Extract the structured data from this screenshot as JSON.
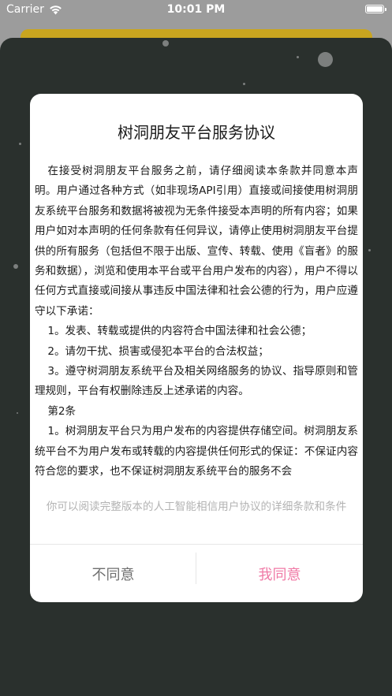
{
  "status_bar": {
    "carrier": "Carrier",
    "time": "10:01 PM"
  },
  "dialog": {
    "title": "树洞朋友平台服务协议",
    "paragraphs": [
      "在接受树洞朋友平台服务之前，请仔细阅读本条款并同意本声明。用户通过各种方式（如非现场API引用）直接或间接使用树洞朋友系统平台服务和数据将被视为无条件接受本声明的所有内容；如果用户如对本声明的任何条款有任何异议，请停止使用树洞朋友平台提供的所有服务（包括但不限于出版、宣传、转载、使用《盲者》的服务和数据），浏览和使用本平台或平台用户发布的内容），用户不得以任何方式直接或间接从事违反中国法律和社会公德的行为，用户应遵守以下承诺：",
      "1。发表、转载或提供的内容符合中国法律和社会公德；",
      "2。请勿干扰、损害或侵犯本平台的合法权益；",
      "3。遵守树洞朋友系统平台及相关网络服务的协议、指导原则和管理规则，平台有权删除违反上述承诺的内容。",
      "第2条",
      "1。树洞朋友平台只为用户发布的内容提供存储空间。树洞朋友系统平台不为用户发布或转载的内容提供任何形式的保证：不保证内容符合您的要求，也不保证树洞朋友系统平台的服务不会"
    ],
    "footer_note": "你可以阅读完整版本的人工智能相信用户协议的详细条款和条件",
    "disagree_label": "不同意",
    "agree_label": "我同意"
  },
  "colors": {
    "agree": "#f07aa6",
    "backdrop": "#2a302d",
    "strip": "#c9a51f"
  }
}
